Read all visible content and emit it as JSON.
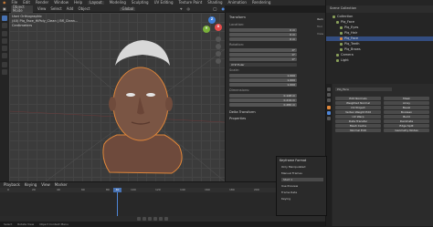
{
  "colors": {
    "accent": "#4772b3",
    "selection": "#334d80",
    "object_active": "#e0873a",
    "x_axis": "#e54b4b",
    "y_axis": "#7ab13a",
    "z_axis": "#3f7fd8"
  },
  "topbar": {
    "menus": [
      "File",
      "Edit",
      "Render",
      "Window",
      "Help"
    ],
    "workspaces": [
      "Layout",
      "Modeling",
      "Sculpting",
      "UV Editing",
      "Texture Paint",
      "Shading",
      "Animation",
      "Rendering"
    ]
  },
  "viewport": {
    "mode": "Object Mode",
    "menus": [
      "View",
      "Select",
      "Add",
      "Object"
    ],
    "transform_orientation": "Global",
    "overlay_lines": [
      "User Orthographic",
      "(40) Plq_Face_HiPoly_Clean | Bfl_Clean...",
      "Centimeters"
    ],
    "nav_icons": [
      "zoom-icon",
      "hand-icon",
      "camera-icon",
      "grid-icon"
    ]
  },
  "npanel": {
    "sections": [
      "Transform",
      "Delta Transform",
      "Properties"
    ],
    "labels": [
      "Location:",
      "Rotation:",
      "XYZ Euler",
      "Scale:",
      "Dimensions:"
    ],
    "values": [
      "0 m",
      "0 m",
      "0 m",
      "0°",
      "0°",
      "0°",
      "1.000",
      "1.000",
      "1.000",
      "0.148 m",
      "0.219 m",
      "0.280 m"
    ],
    "tabs": [
      "Item",
      "Tool",
      "View"
    ]
  },
  "outliner": {
    "title": "Scene Collection",
    "items": [
      {
        "label": "Collection",
        "indent": 1,
        "selected": false
      },
      {
        "label": "Plq_Face",
        "indent": 2,
        "selected": false
      },
      {
        "label": "Plq_Eyes",
        "indent": 3,
        "selected": false
      },
      {
        "label": "Plq_Hair",
        "indent": 3,
        "selected": false
      },
      {
        "label": "Plq_Face",
        "indent": 3,
        "selected": true
      },
      {
        "label": "Plq_Teeth",
        "indent": 3,
        "selected": false
      },
      {
        "label": "Plq_Brows",
        "indent": 3,
        "selected": false
      },
      {
        "label": "Camera",
        "indent": 2,
        "selected": false
      },
      {
        "label": "Light",
        "indent": 2,
        "selected": false
      }
    ]
  },
  "properties": {
    "object_name": "Plq_Face",
    "modifier_buttons": [
      "Edit Normals",
      "Weighted Normal",
      "UV Project",
      "Vertex Weight Edit",
      "UV Warp",
      "Data Transfer",
      "Mesh Cache",
      "Normal Edit"
    ],
    "modifier_buttons_right": [
      "Mask",
      "Array",
      "Bevel",
      "Boolean",
      "Build",
      "Decimate",
      "Edge Split",
      "Geometry Nodes"
    ]
  },
  "popup": {
    "title": "Keyframe Format",
    "rows": [
      "Only Manipulated",
      "Manual Frames",
      "Use Preview",
      "Frame Rate",
      "Keying"
    ],
    "value": "Start 1"
  },
  "timeline": {
    "menus": [
      "Playback",
      "Keying",
      "View",
      "Marker"
    ],
    "ticks": [
      "0",
      "20",
      "40",
      "60",
      "80",
      "100",
      "120",
      "140",
      "160",
      "180",
      "200",
      "220",
      "240"
    ],
    "current_frame": "40",
    "status": [
      "Select",
      "Rotate View",
      "Object Context Menu"
    ]
  }
}
